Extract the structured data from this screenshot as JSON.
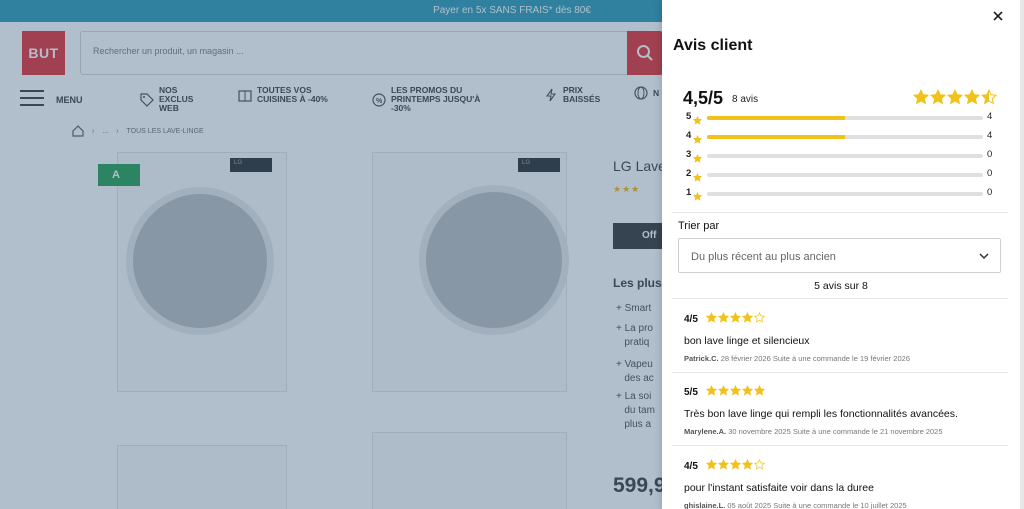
{
  "promo": {
    "text": "Payer en 5x SANS FRAIS* dès 80€"
  },
  "header": {
    "logo": "BUT",
    "search_placeholder": "Rechercher un produit, un magasin ..."
  },
  "nav": {
    "menu_label": "MENU",
    "items": [
      {
        "label": "NOS EXCLUS WEB",
        "icon": "tag-icon"
      },
      {
        "label": "TOUTES VOS CUISINES À -40%",
        "icon": "kitchen-icon"
      },
      {
        "label": "LES PROMOS DU PRINTEMPS JUSQU'À -30%",
        "icon": "promo-tag-icon"
      },
      {
        "label": "PRIX BAISSÉS",
        "icon": "bolt-icon"
      },
      {
        "label": "N",
        "icon": "globe-icon"
      }
    ]
  },
  "breadcrumb": {
    "ellipsis": "...",
    "current": "TOUS LES LAVE-LINGE"
  },
  "product": {
    "title": "LG Lave",
    "energy_class": "A",
    "offer_label": "Off",
    "plus_title": "Les plus",
    "bullets": [
      "+ Smart",
      "+ La pro\n   pratiq",
      "+ Vapeu\n   des ac",
      "+ La soi\n   du tam\n   plus a"
    ],
    "price": "599,9"
  },
  "drawer": {
    "title": "Avis client",
    "score": "4,5/5",
    "review_count": "8 avis",
    "overall_rating": 4.5,
    "accent_color": "#f1c21b",
    "distribution": [
      {
        "stars": "5",
        "count": "4",
        "fraction": 0.5
      },
      {
        "stars": "4",
        "count": "4",
        "fraction": 0.5
      },
      {
        "stars": "3",
        "count": "0",
        "fraction": 0
      },
      {
        "stars": "2",
        "count": "0",
        "fraction": 0
      },
      {
        "stars": "1",
        "count": "0",
        "fraction": 0
      }
    ],
    "sort_label": "Trier par",
    "sort_value": "Du plus récent au plus ancien",
    "showing": "5 avis sur 8",
    "reviews": [
      {
        "score": "4/5",
        "rating": 4,
        "text": "bon lave linge et silencieux",
        "author": "Patrick.C.",
        "date": "28 février 2026 Suite à une commande le 19 février 2026"
      },
      {
        "score": "5/5",
        "rating": 5,
        "text": "Très bon lave linge qui rempli les fonctionnalités avancées.",
        "author": "Marylene.A.",
        "date": "30 novembre 2025 Suite à une commande le 21 novembre 2025"
      },
      {
        "score": "4/5",
        "rating": 4,
        "text": "pour l'instant satisfaite voir dans la duree",
        "author": "ghislaine.L.",
        "date": "05 août 2025 Suite à une commande le 10 juillet 2025"
      }
    ]
  }
}
